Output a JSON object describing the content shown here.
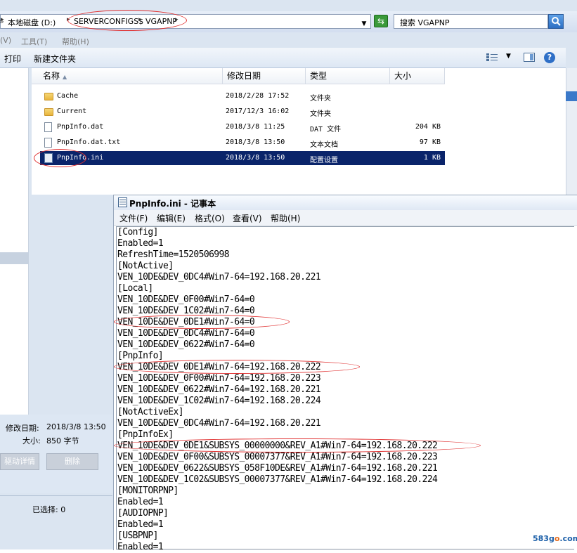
{
  "explorer": {
    "breadcrumb": {
      "prefix": "»",
      "local_disk": "本地磁盘 (D:)",
      "folder1": "SERVERCONFIGS$",
      "folder2": "VGAPNP"
    },
    "search_placeholder": "搜索 VGAPNP",
    "menu": {
      "view": "(V)",
      "tools": "工具(T)",
      "help": "帮助(H)"
    },
    "toolbar": {
      "print": "打印",
      "new_folder": "新建文件夹"
    },
    "columns": {
      "name": "名称",
      "modified": "修改日期",
      "type": "类型",
      "size": "大小"
    },
    "files": [
      {
        "name": "Cache",
        "modified": "2018/2/28 17:52",
        "type": "文件夹",
        "size": "",
        "icon": "folder-icon"
      },
      {
        "name": "Current",
        "modified": "2017/12/3 16:02",
        "type": "文件夹",
        "size": "",
        "icon": "folder-icon"
      },
      {
        "name": "PnpInfo.dat",
        "modified": "2018/3/8 11:25",
        "type": "DAT 文件",
        "size": "204 KB",
        "icon": "file-icon"
      },
      {
        "name": "PnpInfo.dat.txt",
        "modified": "2018/3/8 13:50",
        "type": "文本文档",
        "size": "97 KB",
        "icon": "text-file-icon"
      },
      {
        "name": "PnpInfo.ini",
        "modified": "2018/3/8 13:50",
        "type": "配置设置",
        "size": "1 KB",
        "icon": "ini-file-icon"
      }
    ],
    "details": {
      "modified_label": "修改日期:",
      "modified_value": "2018/3/8 13:50",
      "size_label": "大小:",
      "size_value": "850 字节",
      "btn_driver_details": "驱动详情",
      "btn_delete": "删除"
    },
    "status": "已选择: 0"
  },
  "notepad": {
    "title": "PnpInfo.ini - 记事本",
    "menu": [
      "文件(F)",
      "编辑(E)",
      "格式(O)",
      "查看(V)",
      "帮助(H)"
    ],
    "lines": [
      "[Config]",
      "Enabled=1",
      "RefreshTime=1520506998",
      "[NotActive]",
      "VEN_10DE&DEV_0DC4#Win7-64=192.168.20.221",
      "[Local]",
      "VEN_10DE&DEV_0F00#Win7-64=0",
      "VEN_10DE&DEV_1C02#Win7-64=0",
      "VEN_10DE&DEV_0DE1#Win7-64=0",
      "VEN_10DE&DEV_0DC4#Win7-64=0",
      "VEN_10DE&DEV_0622#Win7-64=0",
      "[PnpInfo]",
      "VEN_10DE&DEV_0DE1#Win7-64=192.168.20.222",
      "VEN_10DE&DEV_0F00#Win7-64=192.168.20.223",
      "VEN_10DE&DEV_0622#Win7-64=192.168.20.221",
      "VEN_10DE&DEV_1C02#Win7-64=192.168.20.224",
      "[NotActiveEx]",
      "VEN_10DE&DEV_0DC4#Win7-64=192.168.20.221",
      "[PnpInfoEx]",
      "VEN_10DE&DEV_0DE1&SUBSYS_00000000&REV_A1#Win7-64=192.168.20.222",
      "VEN_10DE&DEV_0F00&SUBSYS_00007377&REV_A1#Win7-64=192.168.20.223",
      "VEN_10DE&DEV_0622&SUBSYS_058F10DE&REV_A1#Win7-64=192.168.20.221",
      "VEN_10DE&DEV_1C02&SUBSYS_00007377&REV_A1#Win7-64=192.168.20.224",
      "[MONITORPNP]",
      "Enabled=1",
      "[AUDIOPNP]",
      "Enabled=1",
      "[USBPNP]",
      "Enabled=1"
    ]
  },
  "watermark": {
    "prefix": "583g",
    "o": "o",
    "suffix": ".com"
  },
  "colors": {
    "selection": "#0a246a",
    "annotation": "#e03030",
    "explorer_bg": "#dbe5f1"
  }
}
